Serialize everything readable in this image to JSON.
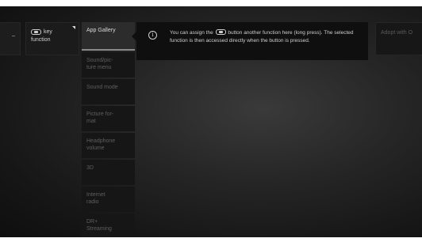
{
  "key_cell": {
    "line1": "key",
    "line2": "function"
  },
  "menu": {
    "items": [
      {
        "label": "App Gallery",
        "selected": true
      },
      {
        "label": "Sound/pic-\nture menu",
        "selected": false
      },
      {
        "label": "Sound mode",
        "selected": false
      },
      {
        "label": "Picture for-\nmat",
        "selected": false
      },
      {
        "label": "Headphone\nvolume",
        "selected": false
      },
      {
        "label": "3D",
        "selected": false
      },
      {
        "label": "Internet\nradio",
        "selected": false
      },
      {
        "label": "DR+\nStreaming",
        "selected": false
      }
    ]
  },
  "info": {
    "text_before": "You can assign the",
    "text_after": "button another function here (long press). The selected function is then accessed directly when the button is pressed."
  },
  "adopt_label": "Adopt with O",
  "colors": {
    "background": "#262626",
    "selected_item": "#2c2c2c",
    "text_light": "#cfcfcf",
    "text_dim": "#5e5e5e"
  }
}
